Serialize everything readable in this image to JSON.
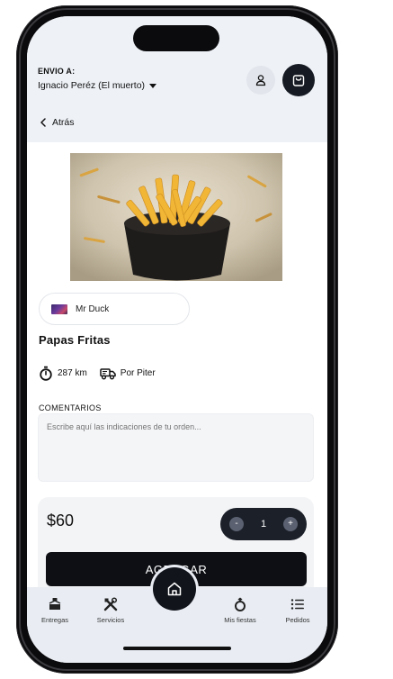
{
  "header": {
    "ship_label": "ENVIO A:",
    "ship_name": "Ignacio Peréz (El muerto)"
  },
  "back": {
    "label": "Atrás"
  },
  "product": {
    "vendor": "Mr Duck",
    "title": "Papas Fritas",
    "distance": "287 km",
    "courier": "Por Piter"
  },
  "comments": {
    "label": "COMENTARIOS",
    "placeholder": "Escribe aquí las indicaciones de tu orden..."
  },
  "order": {
    "price": "$60",
    "minus": "-",
    "quantity": "1",
    "plus": "+",
    "add_label": "AGREGAR"
  },
  "nav": {
    "items": [
      {
        "label": "Entregas",
        "icon": "delivery-icon"
      },
      {
        "label": "Servicios",
        "icon": "tools-icon"
      },
      {
        "label": "",
        "icon": "home-icon"
      },
      {
        "label": "Mis fiestas",
        "icon": "ring-icon"
      },
      {
        "label": "Pedidos",
        "icon": "list-icon"
      }
    ]
  },
  "colors": {
    "header_bg": "#eef2f7",
    "dark": "#161a22",
    "card_bg": "#f3f4f6",
    "nav_bg": "#e9edf3"
  }
}
